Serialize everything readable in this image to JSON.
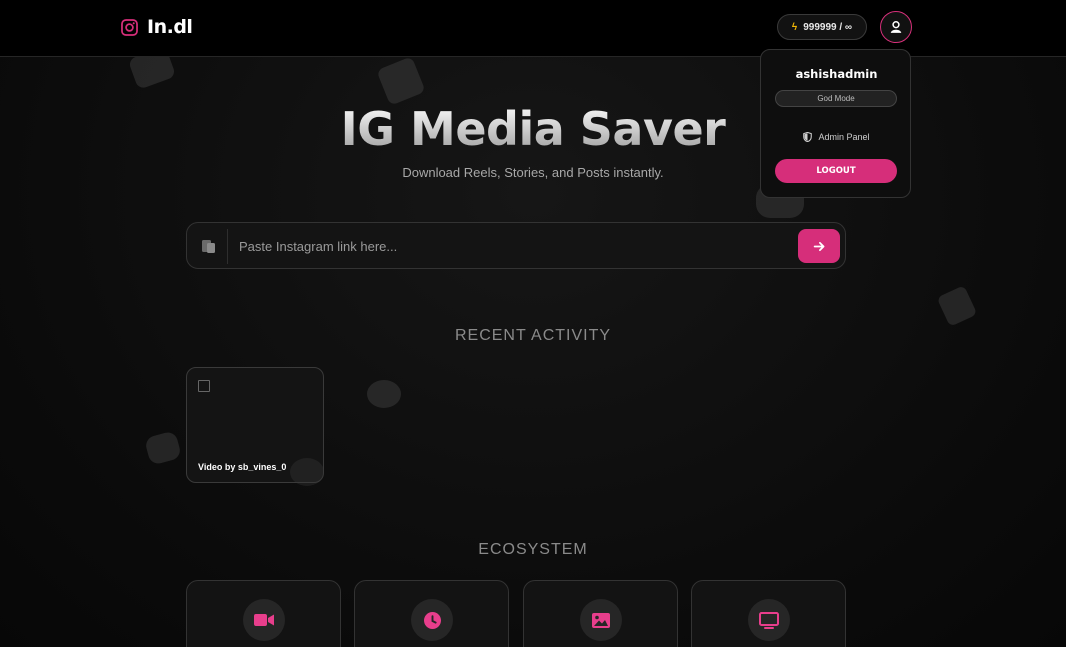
{
  "brand": {
    "name": "In.dl",
    "icon": "instagram-icon",
    "accent": "#d62e7a"
  },
  "header": {
    "credits": "999999 / ∞",
    "credits_icon": "bolt-icon",
    "avatar_icon": "user-icon"
  },
  "hero": {
    "title": "IG Media Saver",
    "subtitle": "Download Reels, Stories, and Posts instantly."
  },
  "search": {
    "placeholder": "Paste Instagram link here...",
    "value": "",
    "paste_icon": "clipboard-icon",
    "submit_icon": "arrow-right-icon"
  },
  "recent": {
    "title": "RECENT ACTIVITY",
    "items": [
      {
        "caption": "Video by sb_vines_0"
      }
    ]
  },
  "ecosystem": {
    "title": "ECOSYSTEM",
    "items": [
      {
        "icon": "video-camera-icon"
      },
      {
        "icon": "clock-icon"
      },
      {
        "icon": "image-icon"
      },
      {
        "icon": "monitor-icon"
      }
    ]
  },
  "user_menu": {
    "username": "ashishadmin",
    "badge": "God Mode",
    "admin_label": "Admin Panel",
    "admin_icon": "shield-icon",
    "logout_label": "LOGOUT"
  }
}
